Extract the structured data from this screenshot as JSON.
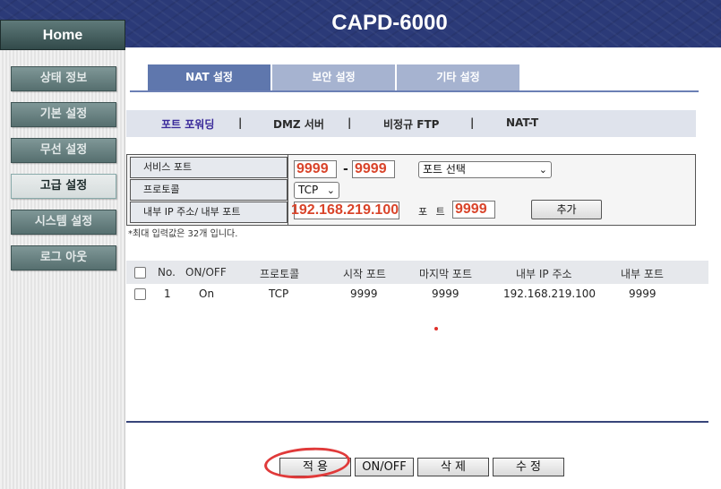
{
  "header": {
    "title": "CAPD-6000"
  },
  "home_tab": {
    "label": "Home"
  },
  "sidebar": {
    "items": [
      {
        "label": "상태 정보"
      },
      {
        "label": "기본 설정"
      },
      {
        "label": "무선 설정"
      },
      {
        "label": "고급 설정"
      },
      {
        "label": "시스템 설정"
      },
      {
        "label": "로그 아웃"
      }
    ]
  },
  "tabs": [
    {
      "label": "NAT 설정"
    },
    {
      "label": "보안 설정"
    },
    {
      "label": "기타 설정"
    }
  ],
  "subnav": {
    "items": [
      {
        "label": "포트 포워딩"
      },
      {
        "label": "DMZ 서버"
      },
      {
        "label": "비정규 FTP"
      },
      {
        "label": "NAT-T"
      }
    ],
    "separator": "|"
  },
  "form": {
    "service_port_label": "서비스 포트",
    "service_port_start": "9999",
    "dash": "-",
    "service_port_end": "9999",
    "port_select_value": "포트 선택",
    "protocol_label": "프로토콜",
    "protocol_value": "TCP",
    "internal_ip_label": "내부 IP 주소/ 내부 포트",
    "internal_ip_value": "192.168.219.100",
    "port_label": "포 트",
    "port_value": "9999",
    "add_button": "추가",
    "note": "*최대 입력값은 32개 입니다."
  },
  "table": {
    "headers": [
      "No.",
      "ON/OFF",
      "프로토콜",
      "시작 포트",
      "마지막 포트",
      "내부 IP 주소",
      "내부 포트"
    ],
    "rows": [
      {
        "no": "1",
        "onoff": "On",
        "protocol": "TCP",
        "start_port": "9999",
        "end_port": "9999",
        "internal_ip": "192.168.219.100",
        "internal_port": "9999"
      }
    ]
  },
  "buttons": {
    "apply": "적 용",
    "onoff": "ON/OFF",
    "delete": "삭 제",
    "edit": "수 정"
  },
  "colors": {
    "header_bg": "#2b3a78",
    "tab_active": "#5f77ad",
    "tab_inactive": "#a6b3d0",
    "annotation_red": "#e03a3a"
  }
}
